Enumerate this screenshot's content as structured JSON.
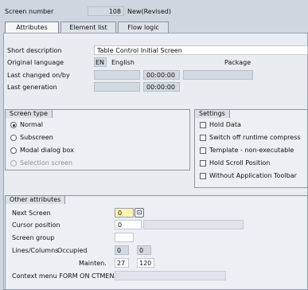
{
  "header": {
    "screen_number_label": "Screen number",
    "screen_number_value": "108",
    "status": "New(Revised)"
  },
  "tabs": [
    {
      "label": "Attributes",
      "active": true
    },
    {
      "label": "Element list",
      "active": false
    },
    {
      "label": "Flow logic",
      "active": false
    }
  ],
  "general": {
    "short_description_label": "Short description",
    "short_description_value": "Table Control Initial Screen",
    "original_language_label": "Original language",
    "original_language_code": "EN",
    "original_language_name": "English",
    "package_label": "Package",
    "last_changed_label": "Last changed on/by",
    "last_changed_time": "00:00:00",
    "last_generation_label": "Last generation",
    "last_generation_time": "00:00:00"
  },
  "screen_type": {
    "title": "Screen type",
    "options": [
      {
        "label": "Normal",
        "selected": true,
        "disabled": false
      },
      {
        "label": "Subscreen",
        "selected": false,
        "disabled": false
      },
      {
        "label": "Modal dialog box",
        "selected": false,
        "disabled": false
      },
      {
        "label": "Selection screen",
        "selected": false,
        "disabled": true
      }
    ]
  },
  "settings": {
    "title": "Settings",
    "options": [
      {
        "label": "Hold Data",
        "checked": false
      },
      {
        "label": "Switch off runtime compress",
        "checked": false
      },
      {
        "label": "Template - non-executable",
        "checked": false
      },
      {
        "label": "Hold Scroll Position",
        "checked": false
      },
      {
        "label": "Without Application Toolbar",
        "checked": false
      }
    ]
  },
  "other_attributes": {
    "title": "Other attributes",
    "next_screen_label": "Next Screen",
    "next_screen_value": "0",
    "cursor_position_label": "Cursor position",
    "cursor_position_value": "0",
    "screen_group_label": "Screen group",
    "screen_group_value": "",
    "lines_columns_label": "Lines/Columns",
    "occupied_label": "Occupied",
    "occupied_lines": "0",
    "occupied_columns": "0",
    "mainten_label": "Mainten.",
    "mainten_lines": "27",
    "mainten_columns": "120",
    "context_menu_label": "Context menu FORM ON CTMENU",
    "context_menu_value": ""
  },
  "colors": {
    "background": "#cfd6df",
    "panel": "#e9ecf0",
    "input_highlight": "#fff4b8"
  }
}
